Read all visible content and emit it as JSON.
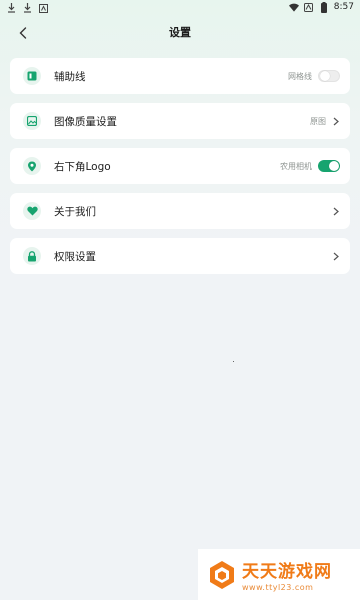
{
  "status_bar": {
    "time": "8:57",
    "left_icons": [
      "download-icon",
      "download-icon",
      "app-icon"
    ],
    "right_icons": [
      "wifi-icon",
      "battery-saver-icon",
      "battery-icon"
    ]
  },
  "header": {
    "title": "设置"
  },
  "settings": {
    "guide_lines": {
      "label": "辅助线",
      "value": "网格线",
      "enabled": false,
      "icon": "grid-guide-icon"
    },
    "image_quality": {
      "label": "图像质量设置",
      "value": "原图",
      "icon": "image-icon"
    },
    "corner_logo": {
      "label": "右下角Logo",
      "value": "农用相机",
      "enabled": true,
      "icon": "location-pin-icon"
    },
    "about": {
      "label": "关于我们",
      "icon": "heart-icon"
    },
    "permissions": {
      "label": "权限设置",
      "icon": "lock-icon"
    }
  },
  "watermark": {
    "title": "天天游戏网",
    "url": "www.ttyl23.com"
  },
  "colors": {
    "accent": "#17a46f",
    "icon_bg": "#e7f4ee",
    "watermark": "#f07b18"
  }
}
